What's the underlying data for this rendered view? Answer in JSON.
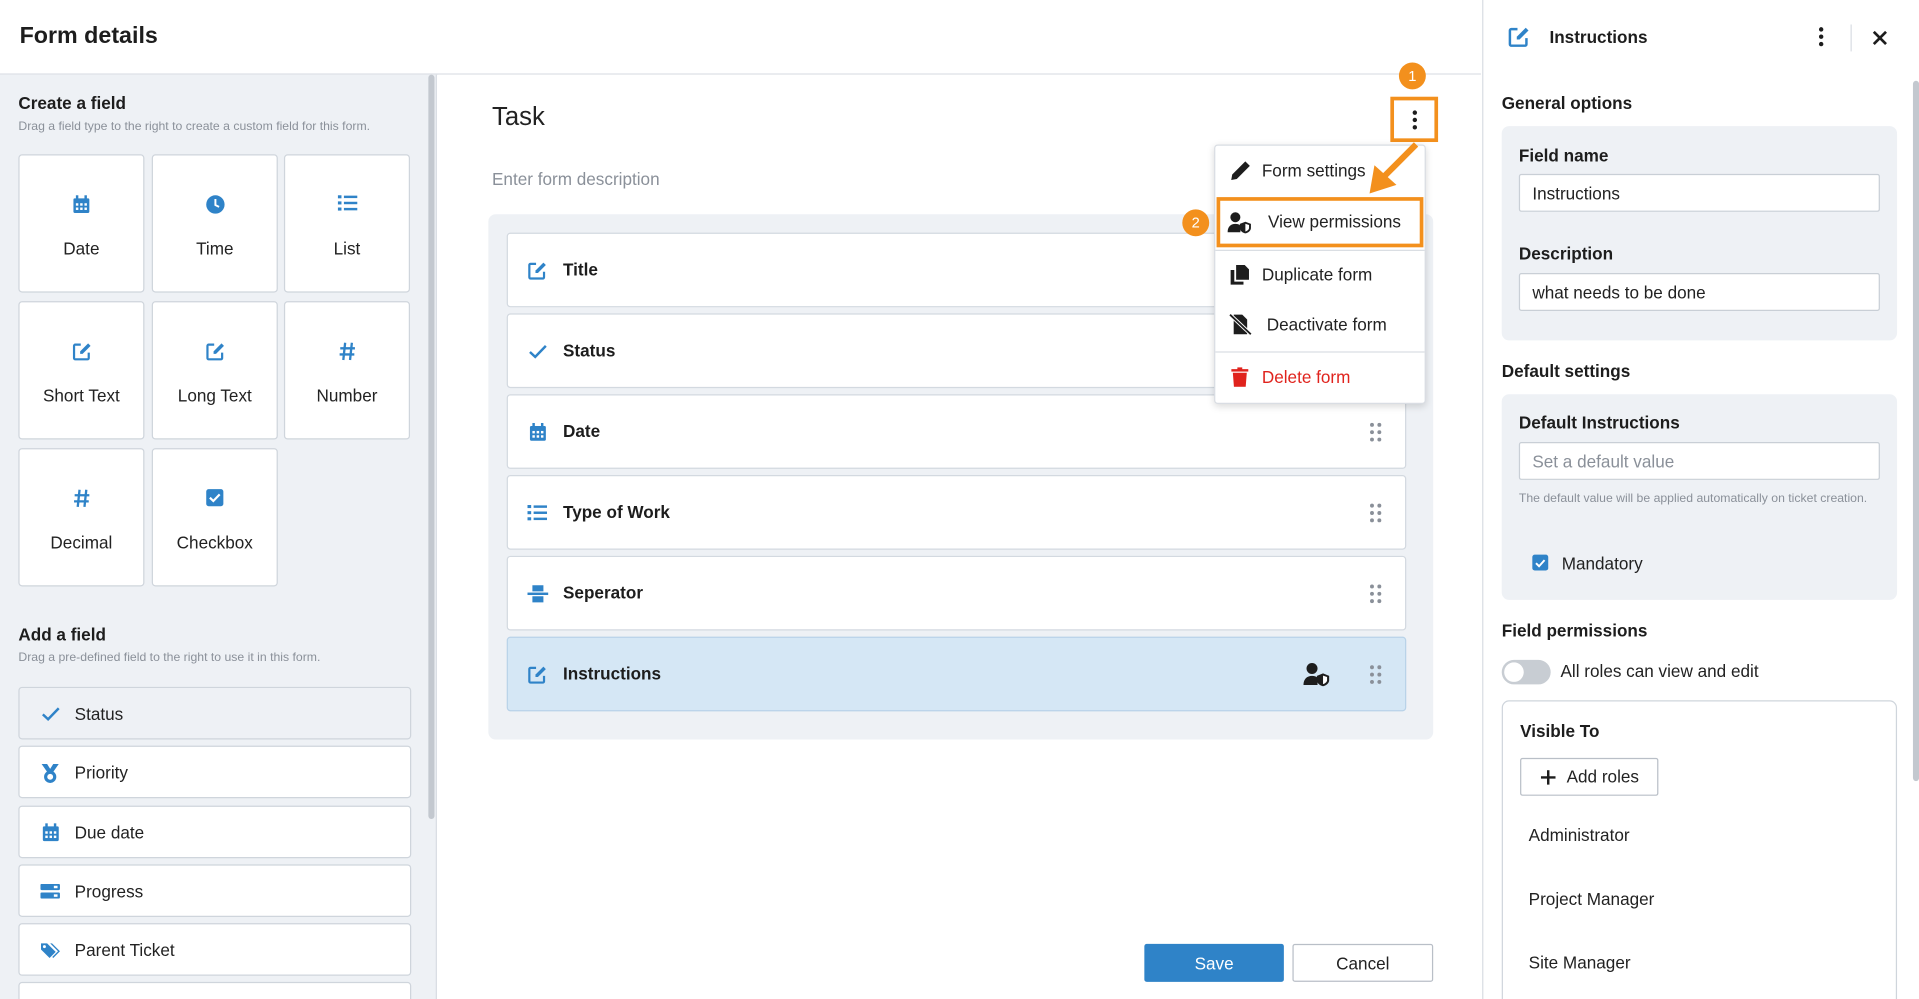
{
  "header": {
    "title": "Form details"
  },
  "create_field": {
    "title": "Create a field",
    "subtitle": "Drag a field type to the right to create a custom field for this form.",
    "tiles": [
      {
        "label": "Date",
        "icon": "calendar-icon"
      },
      {
        "label": "Time",
        "icon": "clock-icon"
      },
      {
        "label": "List",
        "icon": "list-icon"
      },
      {
        "label": "Short Text",
        "icon": "edit-icon"
      },
      {
        "label": "Long Text",
        "icon": "edit-icon"
      },
      {
        "label": "Number",
        "icon": "hash-icon"
      },
      {
        "label": "Decimal",
        "icon": "hash-icon"
      },
      {
        "label": "Checkbox",
        "icon": "checkbox-icon"
      }
    ]
  },
  "add_field": {
    "title": "Add a field",
    "subtitle": "Drag a pre-defined field to the right to use it in this form.",
    "items": [
      {
        "label": "Status",
        "icon": "check-icon"
      },
      {
        "label": "Priority",
        "icon": "medal-icon"
      },
      {
        "label": "Due date",
        "icon": "calendar-icon"
      },
      {
        "label": "Progress",
        "icon": "progress-icon"
      },
      {
        "label": "Parent Ticket",
        "icon": "tags-icon"
      }
    ]
  },
  "form": {
    "title": "Task",
    "description_placeholder": "Enter form description",
    "fields": [
      {
        "label": "Title",
        "icon": "edit-icon"
      },
      {
        "label": "Status",
        "icon": "check-icon"
      },
      {
        "label": "Date",
        "icon": "calendar-icon"
      },
      {
        "label": "Type of Work",
        "icon": "list-icon"
      },
      {
        "label": "Seperator",
        "icon": "separator-icon"
      },
      {
        "label": "Instructions",
        "icon": "edit-icon"
      }
    ],
    "save_label": "Save",
    "cancel_label": "Cancel"
  },
  "steps": {
    "one": "1",
    "two": "2"
  },
  "menu": {
    "items": [
      {
        "label": "Form settings",
        "icon": "pencil-icon"
      },
      {
        "label": "View permissions",
        "icon": "user-shield-icon"
      },
      {
        "label": "Duplicate form",
        "icon": "copy-icon"
      },
      {
        "label": "Deactivate form",
        "icon": "file-off-icon"
      },
      {
        "label": "Delete form",
        "icon": "trash-icon"
      }
    ]
  },
  "panel": {
    "title": "Instructions",
    "general_options": "General options",
    "field_name_label": "Field name",
    "field_name_value": "Instructions",
    "description_label": "Description",
    "description_value": "what needs to be done",
    "default_settings": "Default settings",
    "default_label": "Default Instructions",
    "default_placeholder": "Set a default value",
    "default_hint": "The default value will be applied automatically on ticket creation.",
    "mandatory_label": "Mandatory",
    "mandatory_checked": true,
    "field_permissions": "Field permissions",
    "all_roles_label": "All roles can view and edit",
    "all_roles_on": false,
    "visible_to": "Visible To",
    "add_roles": "Add roles",
    "roles": [
      "Administrator",
      "Project Manager",
      "Site Manager"
    ]
  },
  "colors": {
    "accent": "#2f83c8",
    "highlight": "#f3901d",
    "danger": "#e0231d",
    "panel_bg": "#eef1f5"
  }
}
